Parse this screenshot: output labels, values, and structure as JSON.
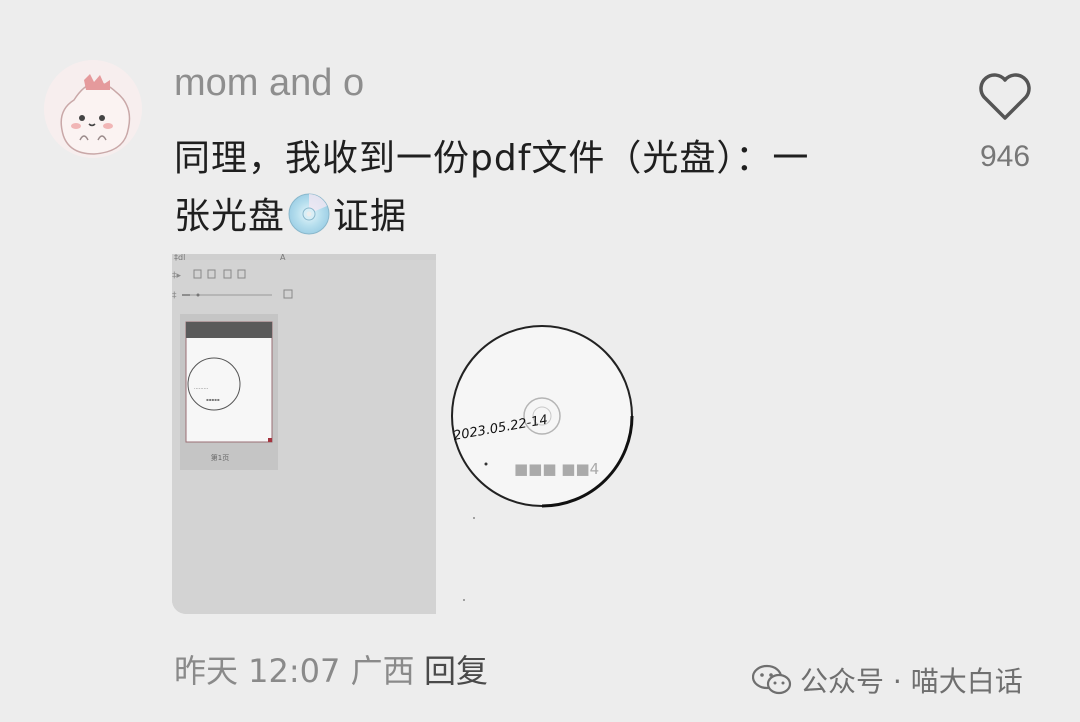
{
  "comment": {
    "username": "mom and o",
    "text_line1": "同理，我收到一份pdf文件（光盘）：一",
    "text_line2_before": "张光盘",
    "text_line2_after": "证据",
    "emoji_icon": "optical-disc-icon"
  },
  "like": {
    "count": "946",
    "icon": "heart-outline-icon"
  },
  "attachments": {
    "pdf_preview_page_label": "第1页",
    "disc_handwriting": "2023.05.22-14",
    "disc_blurred_text": "■■■ ■■4"
  },
  "footer": {
    "time": "昨天 12:07 广西",
    "reply": "回复"
  },
  "watermark": {
    "text": "公众号 · 喵大白话",
    "icon": "wechat-icon"
  }
}
